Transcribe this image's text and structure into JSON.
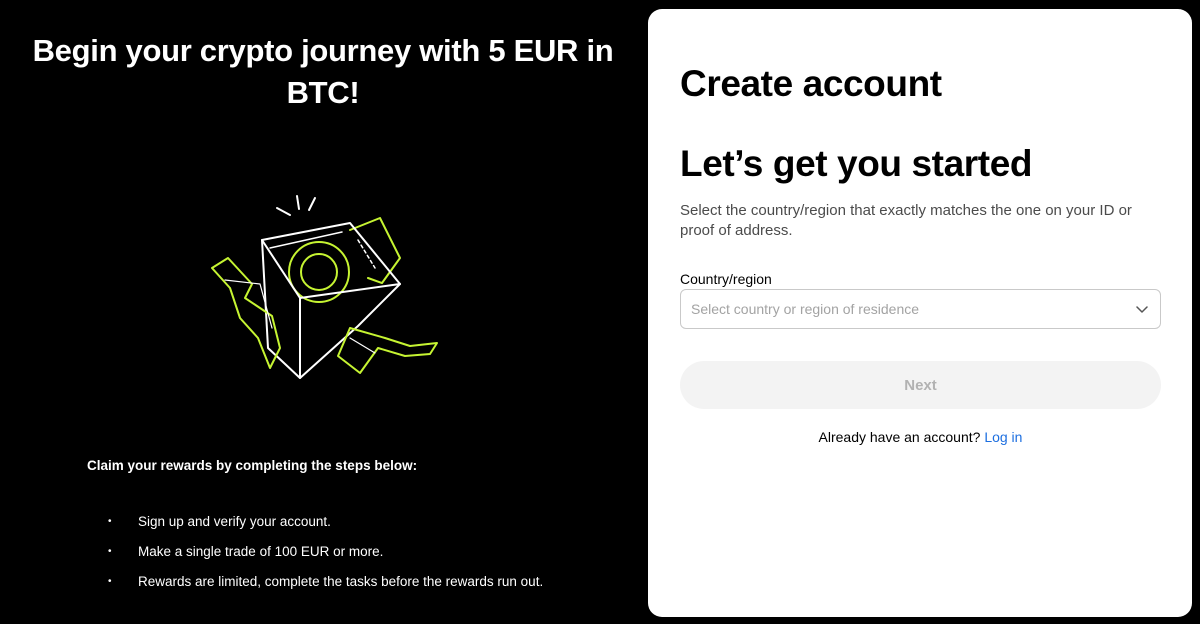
{
  "promo": {
    "title": "Begin your crypto journey with 5 EUR in BTC!",
    "steps_heading": "Claim your rewards by completing the steps below:",
    "steps": [
      "Sign up and verify your account.",
      "Make a single trade of 100 EUR or more.",
      "Rewards are limited, complete the tasks before the rewards run out."
    ],
    "illustration_icon": "gift-box-with-coin-icon",
    "accent_color": "#c6f432"
  },
  "form": {
    "title": "Create account",
    "subtitle": "Let’s get you started",
    "description": "Select the country/region that exactly matches the one on your ID or proof of address.",
    "country_label": "Country/region",
    "country_placeholder": "Select country or region of residence",
    "next_label": "Next",
    "login_prompt": "Already have an account?",
    "login_link": "Log in",
    "link_color": "#1d6fe0"
  }
}
